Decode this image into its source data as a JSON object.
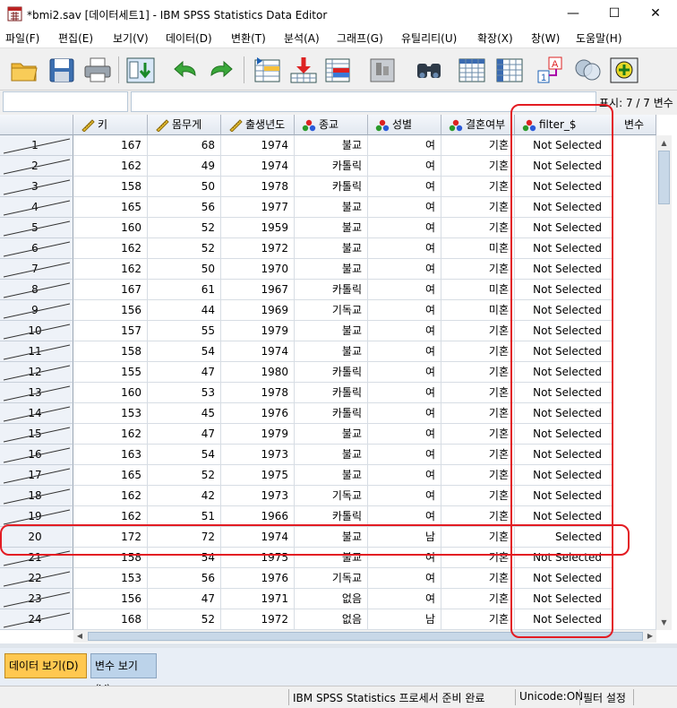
{
  "window": {
    "title": "*bmi2.sav [데이터세트1] - IBM SPSS Statistics Data Editor",
    "minimize": "—",
    "maximize": "☐",
    "close": "✕"
  },
  "menu": [
    "파일(F)",
    "편집(E)",
    "보기(V)",
    "데이터(D)",
    "변환(T)",
    "분석(A)",
    "그래프(G)",
    "유틸리티(U)",
    "확장(X)",
    "창(W)",
    "도움말(H)"
  ],
  "toolbar": {
    "icons": [
      "open-file-icon",
      "save-icon",
      "print-icon",
      "dialog-recall-icon",
      "undo-icon",
      "redo-icon",
      "goto-case-icon",
      "goto-variable-icon",
      "variables-icon",
      "run-descriptives-icon",
      "find-icon",
      "insert-cases-icon",
      "insert-variable-icon",
      "split-file-icon",
      "weight-cases-icon",
      "select-cases-icon",
      "value-labels-icon",
      "use-variable-sets-icon",
      "spelling-icon"
    ]
  },
  "cell_editor": {
    "name": "",
    "value": "",
    "visible_vars": "표시: 7 / 7 변수"
  },
  "columns": [
    {
      "label": "키",
      "kind": "scale"
    },
    {
      "label": "몸무게",
      "kind": "scale"
    },
    {
      "label": "출생년도",
      "kind": "scale"
    },
    {
      "label": "종교",
      "kind": "nominal"
    },
    {
      "label": "성별",
      "kind": "nominal"
    },
    {
      "label": "결혼여부",
      "kind": "nominal"
    },
    {
      "label": "filter_$",
      "kind": "nominal"
    },
    {
      "label": "변수",
      "kind": "empty"
    }
  ],
  "rows": [
    {
      "n": "1",
      "filtered": true,
      "cells": [
        "167",
        "68",
        "1974",
        "불교",
        "여",
        "기혼",
        "Not Selected"
      ]
    },
    {
      "n": "2",
      "filtered": true,
      "cells": [
        "162",
        "49",
        "1974",
        "카톨릭",
        "여",
        "기혼",
        "Not Selected"
      ]
    },
    {
      "n": "3",
      "filtered": true,
      "cells": [
        "158",
        "50",
        "1978",
        "카톨릭",
        "여",
        "기혼",
        "Not Selected"
      ]
    },
    {
      "n": "4",
      "filtered": true,
      "cells": [
        "165",
        "56",
        "1977",
        "불교",
        "여",
        "기혼",
        "Not Selected"
      ]
    },
    {
      "n": "5",
      "filtered": true,
      "cells": [
        "160",
        "52",
        "1959",
        "불교",
        "여",
        "기혼",
        "Not Selected"
      ]
    },
    {
      "n": "6",
      "filtered": true,
      "cells": [
        "162",
        "52",
        "1972",
        "불교",
        "여",
        "미혼",
        "Not Selected"
      ]
    },
    {
      "n": "7",
      "filtered": true,
      "cells": [
        "162",
        "50",
        "1970",
        "불교",
        "여",
        "기혼",
        "Not Selected"
      ]
    },
    {
      "n": "8",
      "filtered": true,
      "cells": [
        "167",
        "61",
        "1967",
        "카톨릭",
        "여",
        "미혼",
        "Not Selected"
      ]
    },
    {
      "n": "9",
      "filtered": true,
      "cells": [
        "156",
        "44",
        "1969",
        "기독교",
        "여",
        "미혼",
        "Not Selected"
      ]
    },
    {
      "n": "10",
      "filtered": true,
      "cells": [
        "157",
        "55",
        "1979",
        "불교",
        "여",
        "기혼",
        "Not Selected"
      ]
    },
    {
      "n": "11",
      "filtered": true,
      "cells": [
        "158",
        "54",
        "1974",
        "불교",
        "여",
        "기혼",
        "Not Selected"
      ]
    },
    {
      "n": "12",
      "filtered": true,
      "cells": [
        "155",
        "47",
        "1980",
        "카톨릭",
        "여",
        "기혼",
        "Not Selected"
      ]
    },
    {
      "n": "13",
      "filtered": true,
      "cells": [
        "160",
        "53",
        "1978",
        "카톨릭",
        "여",
        "기혼",
        "Not Selected"
      ]
    },
    {
      "n": "14",
      "filtered": true,
      "cells": [
        "153",
        "45",
        "1976",
        "카톨릭",
        "여",
        "기혼",
        "Not Selected"
      ]
    },
    {
      "n": "15",
      "filtered": true,
      "cells": [
        "162",
        "47",
        "1979",
        "불교",
        "여",
        "기혼",
        "Not Selected"
      ]
    },
    {
      "n": "16",
      "filtered": true,
      "cells": [
        "163",
        "54",
        "1973",
        "불교",
        "여",
        "기혼",
        "Not Selected"
      ]
    },
    {
      "n": "17",
      "filtered": true,
      "cells": [
        "165",
        "52",
        "1975",
        "불교",
        "여",
        "기혼",
        "Not Selected"
      ]
    },
    {
      "n": "18",
      "filtered": true,
      "cells": [
        "162",
        "42",
        "1973",
        "기독교",
        "여",
        "기혼",
        "Not Selected"
      ]
    },
    {
      "n": "19",
      "filtered": true,
      "cells": [
        "162",
        "51",
        "1966",
        "카톨릭",
        "여",
        "기혼",
        "Not Selected"
      ]
    },
    {
      "n": "20",
      "filtered": false,
      "cells": [
        "172",
        "72",
        "1974",
        "불교",
        "남",
        "기혼",
        "Selected"
      ]
    },
    {
      "n": "21",
      "filtered": true,
      "cells": [
        "158",
        "54",
        "1975",
        "불교",
        "여",
        "기혼",
        "Not Selected"
      ]
    },
    {
      "n": "22",
      "filtered": true,
      "cells": [
        "153",
        "56",
        "1976",
        "기독교",
        "여",
        "기혼",
        "Not Selected"
      ]
    },
    {
      "n": "23",
      "filtered": true,
      "cells": [
        "156",
        "47",
        "1971",
        "없음",
        "여",
        "기혼",
        "Not Selected"
      ]
    },
    {
      "n": "24",
      "filtered": true,
      "cells": [
        "168",
        "52",
        "1972",
        "없음",
        "남",
        "기혼",
        "Not Selected"
      ]
    }
  ],
  "tabs": {
    "data_view": "데이터 보기(D)",
    "variable_view": "변수 보기(V)"
  },
  "status": {
    "processor": "IBM SPSS Statistics 프로세서 준비 완료",
    "unicode": "Unicode:ON",
    "filter": "필터 설정"
  },
  "colors": {
    "annotation_red": "#e31c23",
    "active_tab": "#ffc850",
    "inactive_tab": "#bcd3ea"
  }
}
